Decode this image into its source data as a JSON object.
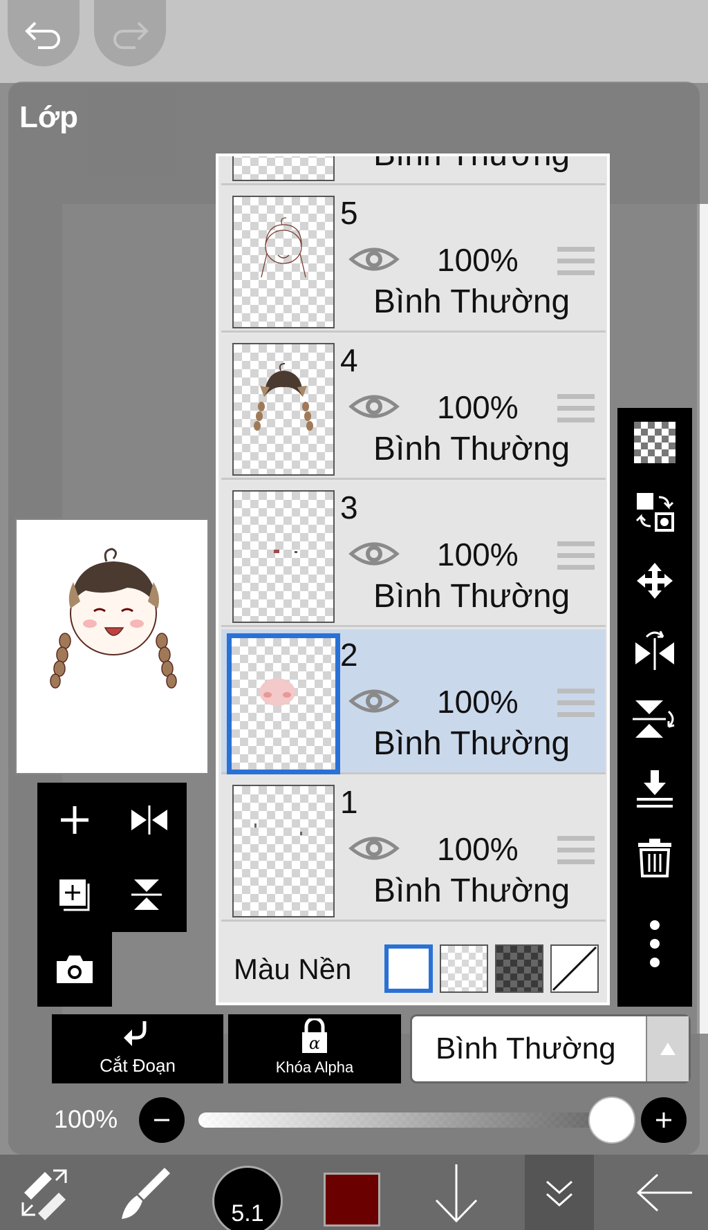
{
  "panel": {
    "title": "Lớp"
  },
  "layers": [
    {
      "id": "partial-top",
      "number": "",
      "opacity": "",
      "blend": "Bình Thường",
      "selected": false
    },
    {
      "id": "l5",
      "number": "5",
      "opacity": "100%",
      "blend": "Bình Thường",
      "selected": false
    },
    {
      "id": "l4",
      "number": "4",
      "opacity": "100%",
      "blend": "Bình Thường",
      "selected": false
    },
    {
      "id": "l3",
      "number": "3",
      "opacity": "100%",
      "blend": "Bình Thường",
      "selected": false
    },
    {
      "id": "l2",
      "number": "2",
      "opacity": "100%",
      "blend": "Bình Thường",
      "selected": true
    },
    {
      "id": "l1",
      "number": "1",
      "opacity": "100%",
      "blend": "Bình Thường",
      "selected": false
    }
  ],
  "background_row": {
    "label": "Màu Nền",
    "options": [
      "white",
      "light-checker",
      "dark-checker",
      "none"
    ],
    "selected": "white"
  },
  "buttons": {
    "clipping": "Cắt Đoạn",
    "alpha_lock": "Khóa Alpha"
  },
  "blend_mode": {
    "value": "Bình Thường"
  },
  "layer_opacity": {
    "label": "100%",
    "value": 1.0
  },
  "brush": {
    "size": "5.1"
  },
  "colors": {
    "current": "#6b0000",
    "selection": "#2a71d6",
    "selected_row": "#cad8ec"
  },
  "icons": {
    "top": [
      "undo-icon",
      "redo-icon"
    ],
    "left_tools": [
      "add-layer-icon",
      "flip-horizontal-icon",
      "add-layer-copy-icon",
      "flip-vertical-icon",
      "camera-icon"
    ],
    "right_tools": [
      "transparency-icon",
      "swap-layer-icon",
      "move-icon",
      "flip-horizontal-icon",
      "flip-vertical-icon",
      "merge-down-icon",
      "trash-icon",
      "more-icon"
    ],
    "bottom": [
      "transform-icon",
      "brush-icon",
      "brush-size-icon",
      "color-icon",
      "arrow-down-icon",
      "double-chevron-down-icon",
      "back-arrow-icon"
    ]
  }
}
